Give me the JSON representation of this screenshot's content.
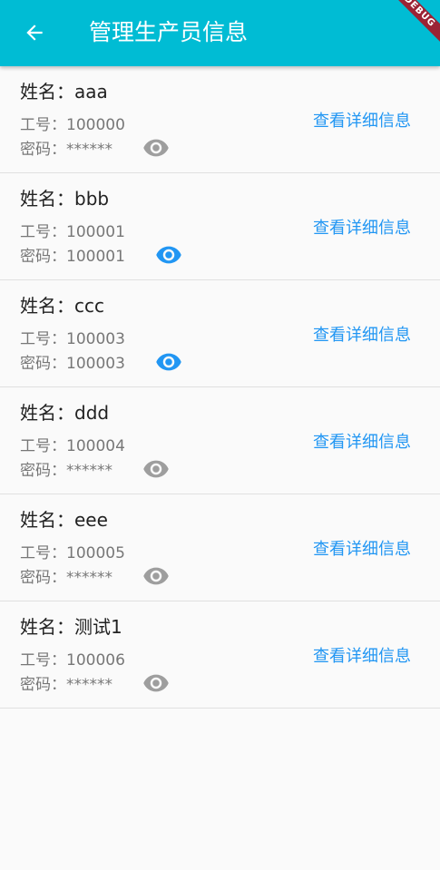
{
  "appbar": {
    "title": "管理生产员信息",
    "back_icon": "arrow-back-icon",
    "background": "#00bcd4",
    "debug_banner": "DEBUG"
  },
  "employees": [
    {
      "name_line": "姓名：aaa",
      "workno_line": "工号：100000",
      "password_line": "密码：******",
      "password_visible": false,
      "detail_label": "查看详细信息"
    },
    {
      "name_line": "姓名：bbb",
      "workno_line": "工号：100001",
      "password_line": "密码：100001",
      "password_visible": true,
      "detail_label": "查看详细信息"
    },
    {
      "name_line": "姓名：ccc",
      "workno_line": "工号：100003",
      "password_line": "密码：100003",
      "password_visible": true,
      "detail_label": "查看详细信息"
    },
    {
      "name_line": "姓名：ddd",
      "workno_line": "工号：100004",
      "password_line": "密码：******",
      "password_visible": false,
      "detail_label": "查看详细信息"
    },
    {
      "name_line": "姓名：eee",
      "workno_line": "工号：100005",
      "password_line": "密码：******",
      "password_visible": false,
      "detail_label": "查看详细信息"
    },
    {
      "name_line": "姓名：测试1",
      "workno_line": "工号：100006",
      "password_line": "密码：******",
      "password_visible": false,
      "detail_label": "查看详细信息"
    }
  ],
  "colors": {
    "accent": "#2196f3",
    "eye_active": "#2196f3",
    "eye_inactive": "#9e9e9e"
  },
  "icons": {
    "visibility": "eye-icon"
  }
}
